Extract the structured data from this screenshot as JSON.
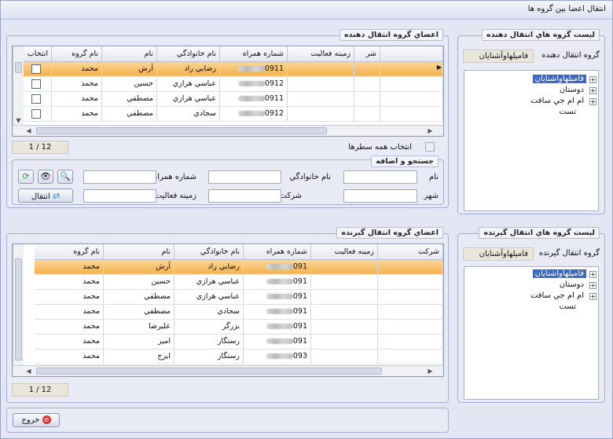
{
  "window": {
    "title": "انتقال اعضا بين گروه ها"
  },
  "sourceGroups": {
    "title": "ليست گروه هاي انتقال دهنده",
    "label": "گروه انتقال دهنده",
    "selected": "فاميلهاوآشنايان",
    "tree": [
      "فاميلهاوآشنايان",
      "دوستان",
      "ام ام جي سافت",
      "تست"
    ]
  },
  "targetGroups": {
    "title": "ليست گروه هاي انتقال گيرنده",
    "label": "گروه انتقال گيرنده",
    "selected": "فاميلهاوآشنايان",
    "tree": [
      "فاميلهاوآشنايان",
      "دوستان",
      "ام ام جي سافت",
      "تست"
    ]
  },
  "sourceMembers": {
    "title": "اعضاي گروه انتقال دهنده",
    "columns": [
      "انتخاب",
      "نام گروه",
      "نام",
      "نام خانوادگي",
      "شماره همراه",
      "زمينه فعاليت",
      "شر"
    ],
    "rows": [
      {
        "group": "محمد",
        "name": "آرش",
        "family": "رضايي راد",
        "mobile": "0911"
      },
      {
        "group": "محمد",
        "name": "حسين",
        "family": "عباسي هرازي",
        "mobile": "0912"
      },
      {
        "group": "محمد",
        "name": "مصطفي",
        "family": "عباسي هرازي",
        "mobile": "0911"
      },
      {
        "group": "محمد",
        "name": "مصطفي",
        "family": "سجادي",
        "mobile": "0912"
      }
    ],
    "pager": "1 / 12",
    "selectAll": "انتخاب همه سطرها"
  },
  "search": {
    "title": "جستجو و اضافه",
    "fields": {
      "name": "نام",
      "family": "نام خانوادگي",
      "mobile": "شماره همراه",
      "city": "شهر",
      "company": "شركت",
      "activity": "زمينه فعاليت"
    },
    "transferButton": "انتقال"
  },
  "targetMembers": {
    "title": "اعضاي گروه انتقال گيرنده",
    "columns": [
      "نام گروه",
      "نام",
      "نام خانوادگي",
      "شماره همراه",
      "زمينه فعاليت",
      "شركت"
    ],
    "rows": [
      {
        "group": "محمد",
        "name": "آرش",
        "family": "رضايي راد",
        "mobile": "091"
      },
      {
        "group": "محمد",
        "name": "حسين",
        "family": "عباسي هرازي",
        "mobile": "091"
      },
      {
        "group": "محمد",
        "name": "مصطفي",
        "family": "عباسي هرازي",
        "mobile": "091"
      },
      {
        "group": "محمد",
        "name": "مصطفي",
        "family": "سجادي",
        "mobile": "091"
      },
      {
        "group": "محمد",
        "name": "عليرضا",
        "family": "بزرگر",
        "mobile": "091"
      },
      {
        "group": "محمد",
        "name": "امير",
        "family": "رستگار",
        "mobile": "091"
      },
      {
        "group": "محمد",
        "name": "ايرج",
        "family": "رستگار",
        "mobile": "093"
      }
    ],
    "pager": "1 / 12"
  },
  "footer": {
    "exitButton": "خروج"
  },
  "colors": {
    "selectionRow": "#f4b24d",
    "treeSelection": "#3b67c6",
    "exitIcon": "#d9342b",
    "transferIcon": "#2f8fd8"
  }
}
